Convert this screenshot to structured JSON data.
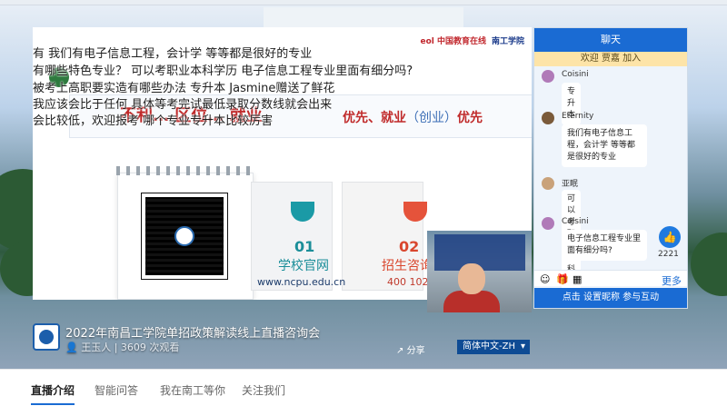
{
  "stage": {
    "logo_a": "eol 中国教育在线",
    "logo_b": "南工学院",
    "headline": "不利… 区位… 就业",
    "headline_tail": "优先、就业",
    "headline_paren": "（创业）",
    "headline_end": "优先",
    "steps": [
      {
        "num": "01",
        "title": "学校官网",
        "sub": "www.ncpu.edu.cn"
      },
      {
        "num": "02",
        "title": "招生咨询",
        "sub": "400 102 …"
      }
    ]
  },
  "danmaku": [
    "有  我们有电子信息工程，会计学 等等都是很好的专业",
    "有哪些特色专业？   可以考职业本科学历      电子信息工程专业里面有细分吗?",
    "被考上高职要实造有哪些办法    专升本    Jasmine赠送了鲜花",
    "我应该会比于任何   具体等考完试最低录取分数线就会出来",
    "会比较低，欢迎报考   哪个专业专升本比较厉害"
  ],
  "live": {
    "title": "2022年南昌工学院单招政策解读线上直播咨询会",
    "host": "王玉人",
    "views": "3609 次观看",
    "share": "分享",
    "language": "简体中文-ZH"
  },
  "chat": {
    "header": "聊天",
    "welcome": "欢迎 贾嘉 加入",
    "messages": [
      {
        "nick": "Coisini",
        "text": "专升本",
        "color": "#b07ab8"
      },
      {
        "nick": "Eternity",
        "text": "我们有电子信息工程，会计学 等等都是很好的专业",
        "color": "#7a5a3a"
      },
      {
        "nick": "亚眠",
        "text": "可以考职业本科学历",
        "color": "#c9a27a"
      },
      {
        "nick": "Coisini",
        "text": "电子信息工程专业里面有细分吗?",
        "color": "#b07ab8"
      }
    ],
    "like_count": "2221",
    "more": "更多",
    "login_prompt": "点击 设置昵称 参与互动"
  },
  "tabs": [
    "直播介绍",
    "智能问答",
    "我在南工等你",
    "关注我们"
  ]
}
